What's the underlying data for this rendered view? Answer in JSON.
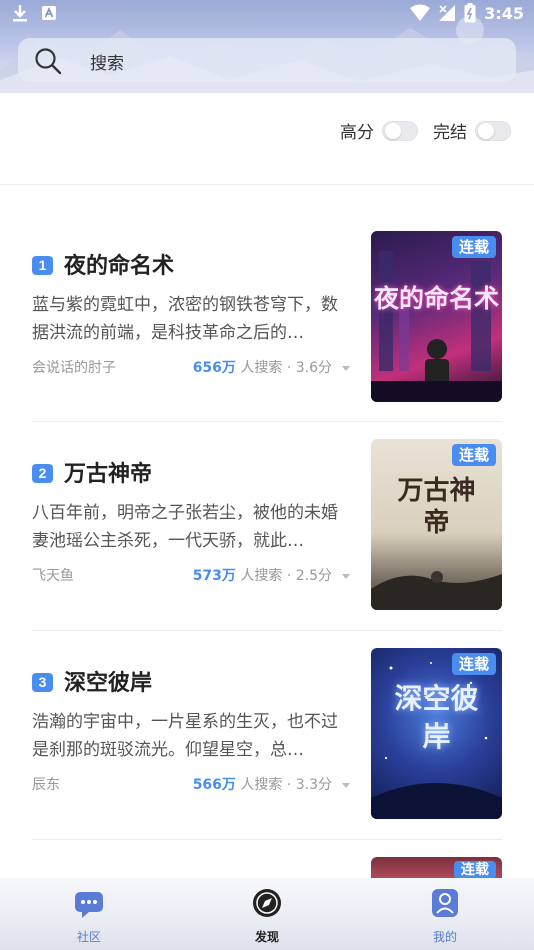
{
  "status_bar": {
    "time": "3:45"
  },
  "search": {
    "placeholder": "搜索"
  },
  "filters": [
    {
      "label": "高分",
      "on": false
    },
    {
      "label": "完结",
      "on": false
    }
  ],
  "books": [
    {
      "rank": "1",
      "title": "夜的命名术",
      "desc": "蓝与紫的霓虹中，浓密的钢铁苍穹下，数据洪流的前端，是科技革命之后的…",
      "author": "会说话的肘子",
      "search_count": "656万",
      "search_suffix": "人搜索 · 3.6分",
      "tag": "连载",
      "cover_title": "夜的命名术"
    },
    {
      "rank": "2",
      "title": "万古神帝",
      "desc": "八百年前，明帝之子张若尘，被他的未婚妻池瑶公主杀死，一代天骄，就此…",
      "author": "飞天鱼",
      "search_count": "573万",
      "search_suffix": "人搜索 · 2.5分",
      "tag": "连载",
      "cover_title": "万古神帝"
    },
    {
      "rank": "3",
      "title": "深空彼岸",
      "desc": "浩瀚的宇宙中，一片星系的生灭，也不过是刹那的斑驳流光。仰望星空，总…",
      "author": "辰东",
      "search_count": "566万",
      "search_suffix": "人搜索 · 3.3分",
      "tag": "连载",
      "cover_title": "深空彼岸"
    }
  ],
  "partial_book": {
    "tag": "连载"
  },
  "nav": [
    {
      "label": "社区",
      "active": false
    },
    {
      "label": "发现",
      "active": true
    },
    {
      "label": "我的",
      "active": false
    }
  ],
  "colors": {
    "accent": "#4a8df0",
    "nav_inactive": "#5a7bd6",
    "nav_active": "#222222"
  }
}
